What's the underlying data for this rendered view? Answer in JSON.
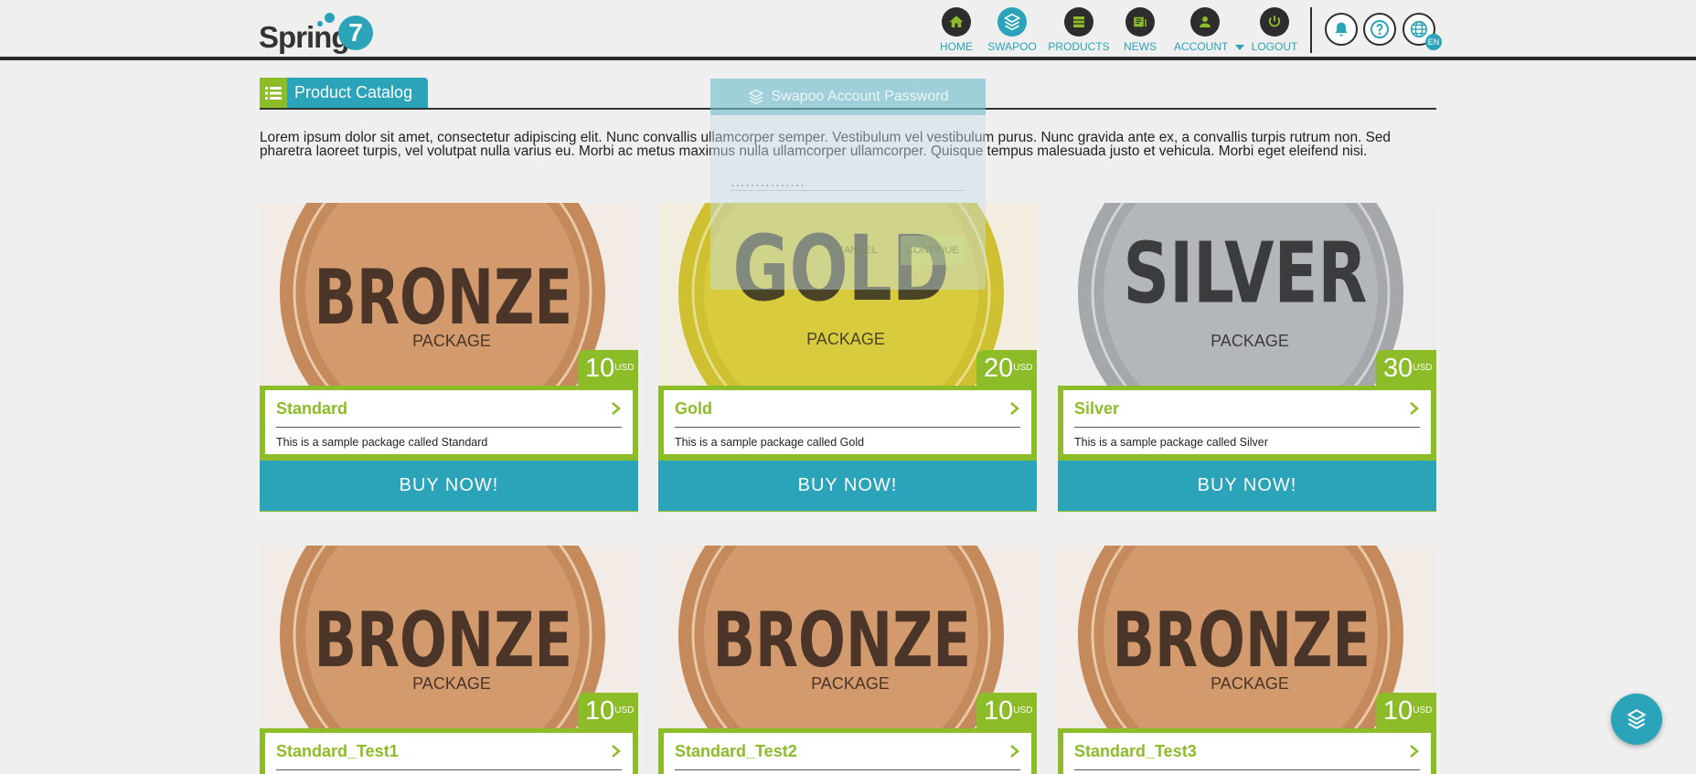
{
  "brand": {
    "logo_text": "Spring",
    "logo_num": "7"
  },
  "nav": {
    "items": [
      {
        "label": "HOME",
        "icon": "home-icon"
      },
      {
        "label": "SWAPOO",
        "icon": "swapoo-icon"
      },
      {
        "label": "PRODUCTS",
        "icon": "products-grid-icon"
      },
      {
        "label": "NEWS",
        "icon": "news-icon"
      },
      {
        "label": "ACCOUNT",
        "icon": "user-icon"
      },
      {
        "label": "LOGOUT",
        "icon": "power-icon"
      }
    ],
    "language_badge": "EN"
  },
  "page": {
    "title": "Product Catalog",
    "intro": "Lorem ipsum dolor sit amet, consectetur adipiscing elit. Nunc convallis ullamcorper semper. Vestibulum vel vestibulum purus. Nunc gravida ante ex, a convallis turpis rutrum non. Sed pharetra laoreet turpis, vel volutpat nulla varius eu. Morbi ac metus maximus nulla ullamcorper ullamcorper. Quisque tempus malesuada justo et vehicula. Morbi eget eleifend nisi."
  },
  "products": [
    {
      "name": "Standard",
      "desc": "This is a sample package called Standard",
      "price": "10",
      "currency": "USD",
      "badge": "BRONZE",
      "badge_sub": "PACKAGE",
      "buy": "BUY NOW!"
    },
    {
      "name": "Gold",
      "desc": "This is a sample package called Gold",
      "price": "20",
      "currency": "USD",
      "badge": "GOLD",
      "badge_sub": "PACKAGE",
      "buy": "BUY NOW!"
    },
    {
      "name": "Silver",
      "desc": "This is a sample package called Silver",
      "price": "30",
      "currency": "USD",
      "badge": "SILVER",
      "badge_sub": "PACKAGE",
      "buy": "BUY NOW!"
    },
    {
      "name": "Standard_Test1",
      "price": "10",
      "currency": "USD",
      "badge": "BRONZE",
      "badge_sub": "PACKAGE"
    },
    {
      "name": "Standard_Test2",
      "price": "10",
      "currency": "USD",
      "badge": "BRONZE",
      "badge_sub": "PACKAGE"
    },
    {
      "name": "Standard_Test3",
      "price": "10",
      "currency": "USD",
      "badge": "BRONZE",
      "badge_sub": "PACKAGE"
    }
  ],
  "modal": {
    "title": "Swapoo Account Password",
    "password_mask": "...............",
    "cancel": "CANCEL",
    "continue": "CONTINUE"
  },
  "colors": {
    "accent": "#2ba3b8",
    "green": "#8cbc28",
    "dark": "#2d2d2d"
  }
}
